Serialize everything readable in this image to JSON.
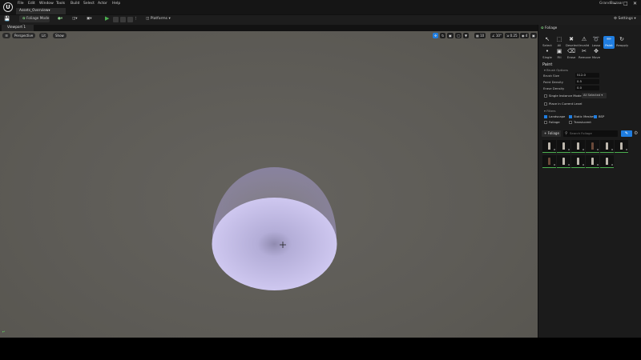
{
  "menu": [
    "File",
    "Edit",
    "Window",
    "Tools",
    "Build",
    "Select",
    "Actor",
    "Help"
  ],
  "project_tab": "Assets_Overview▾",
  "project_name": "GrandBazaar",
  "window_buttons": [
    "–",
    "□",
    "✕"
  ],
  "toolbar": {
    "mode_label": "Foliage Mode",
    "platforms_label": "Platforms",
    "settings_label": "Settings"
  },
  "viewport": {
    "tab_label": "Viewport 1",
    "perspective_label": "Perspective",
    "lit_label": "Lit",
    "show_label": "Show",
    "grid_snap": "10",
    "rotate_snap": "10°",
    "scale_snap": "0.25",
    "camera_speed": "4"
  },
  "panel": {
    "tab_label": "Foliage",
    "tools": [
      {
        "label": "Select",
        "glyph": "↖"
      },
      {
        "label": "All",
        "glyph": "⬚"
      },
      {
        "label": "Deselect",
        "glyph": "✖"
      },
      {
        "label": "Invalid",
        "glyph": "⚠"
      },
      {
        "label": "Lasso",
        "glyph": "➰"
      },
      {
        "label": "Paint",
        "glyph": "✏"
      },
      {
        "label": "Reapply",
        "glyph": "↻"
      },
      {
        "label": "Single",
        "glyph": "•"
      },
      {
        "label": "Fill",
        "glyph": "▣"
      },
      {
        "label": "Erase",
        "glyph": "⌫"
      },
      {
        "label": "Remove",
        "glyph": "✂"
      },
      {
        "label": "Move",
        "glyph": "✥"
      }
    ],
    "section_title": "Paint",
    "brush_options_header": "Brush Options",
    "brush_size_label": "Brush Size",
    "brush_size_value": "512.0",
    "paint_density_label": "Paint Density",
    "paint_density_value": "0.5",
    "erase_density_label": "Erase Density",
    "erase_density_value": "0.0",
    "single_instance_label": "Single Instance Mode",
    "single_instance_dropdown": "All Selected ▾",
    "place_current_level_label": "Place in Current Level",
    "filters_header": "Filters",
    "filters": [
      {
        "label": "Landscape",
        "checked": true
      },
      {
        "label": "Static Meshes",
        "checked": true
      },
      {
        "label": "BSP",
        "checked": true
      },
      {
        "label": "Foliage",
        "checked": false
      },
      {
        "label": "Translucent",
        "checked": false
      }
    ],
    "add_foliage_label": "+ Foliage",
    "search_placeholder": "Search Foliage",
    "thumb_count": "0"
  }
}
